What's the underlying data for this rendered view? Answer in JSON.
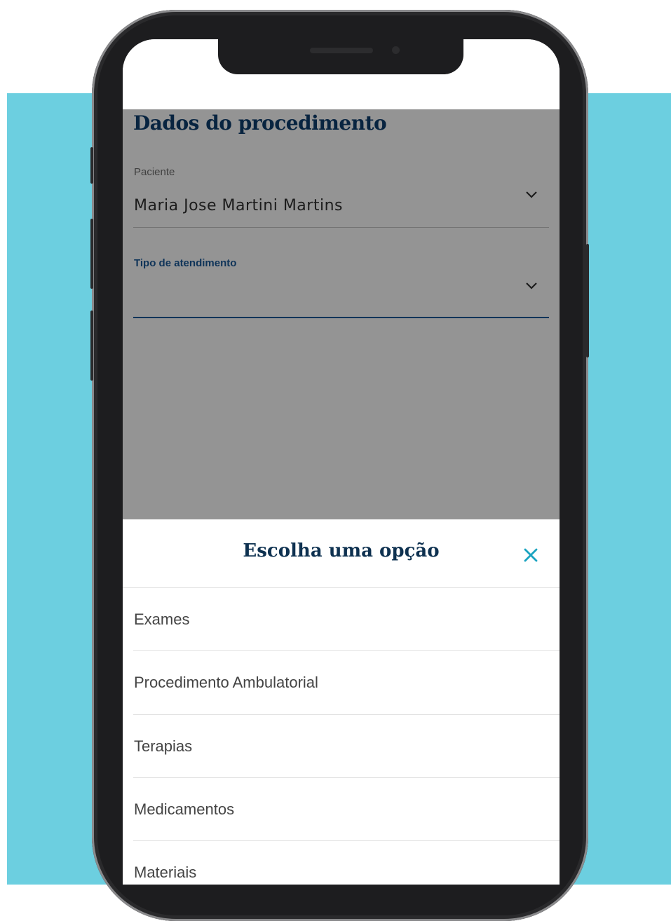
{
  "form": {
    "title": "Dados do procedimento",
    "patient_label": "Paciente",
    "patient_value": "Maria Jose Martini Martins",
    "service_type_label": "Tipo de atendimento"
  },
  "sheet": {
    "title": "Escolha uma opção",
    "options": [
      {
        "label": "Exames"
      },
      {
        "label": "Procedimento Ambulatorial"
      },
      {
        "label": "Terapias"
      },
      {
        "label": "Medicamentos"
      },
      {
        "label": "Materiais"
      }
    ]
  },
  "colors": {
    "background": "#6ccfe0",
    "title": "#0e3e6e",
    "accent": "#1a5a9a",
    "close_icon": "#1aa3c0"
  }
}
